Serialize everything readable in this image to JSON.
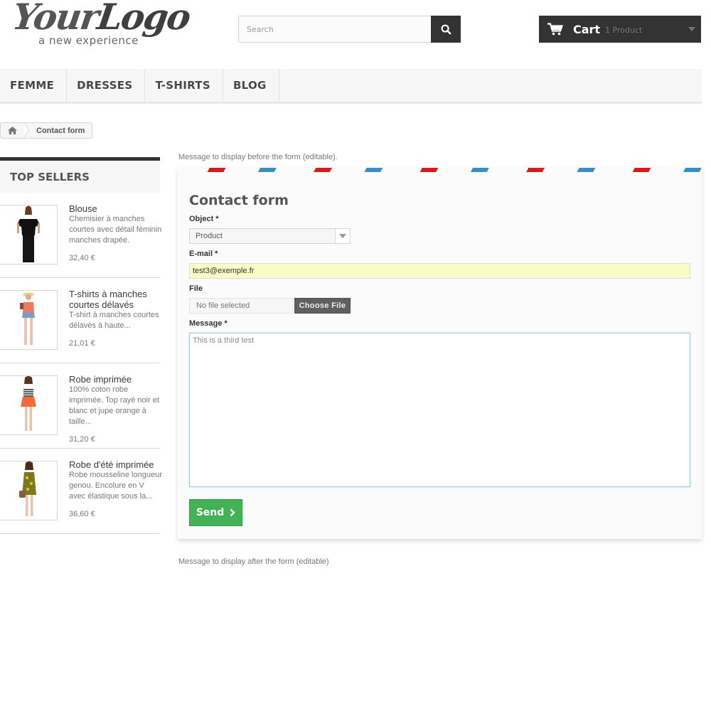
{
  "header": {
    "logo": {
      "script_part1": "Your",
      "script_part2": "Logo",
      "tagline": "a new experience"
    },
    "search": {
      "placeholder": "Search",
      "value": "",
      "icon": "search-icon"
    },
    "cart": {
      "label": "Cart",
      "quantity": "1 Product",
      "icon": "cart-icon"
    }
  },
  "menu": {
    "items": [
      {
        "label": "FEMME"
      },
      {
        "label": "DRESSES"
      },
      {
        "label": "T-SHIRTS"
      },
      {
        "label": "BLOG"
      }
    ]
  },
  "breadcrumb": {
    "home_icon": "home-icon",
    "current": "Contact form"
  },
  "sidebar": {
    "title": "TOP SELLERS",
    "products": [
      {
        "name": "Blouse",
        "description": "Chemisier à manches courtes avec détail féminin manches drapée.",
        "price": "32,40 €",
        "image": "black-blouse"
      },
      {
        "name": "T-shirts à manches courtes délavés",
        "description": "T-shirt à manches courtes délavés à haute...",
        "price": "21,01 €",
        "image": "orange-tshirt"
      },
      {
        "name": "Robe imprimée",
        "description": "100% coton robe imprimée. Top rayé noir et blanc et jupe orange à taille...",
        "price": "31,20 €",
        "image": "striped-dress"
      },
      {
        "name": "Robe d'été imprimée",
        "description": "Robe mousseline longueur genou. Encolure en V avec élastique sous la...",
        "price": "36,60 €",
        "image": "yellow-summer-dress"
      }
    ]
  },
  "main": {
    "before_message": "Message to display before the form (editable).",
    "after_message": "Message to display after the form (editable)",
    "stripe_colors": {
      "blue": "#3b8ec2",
      "red": "#d31d1d"
    },
    "form": {
      "title": "Contact form",
      "object_label": "Object *",
      "object_value": "Product",
      "email_label": "E-mail *",
      "email_value": "test3@exemple.fr",
      "file_label": "File",
      "file_status": "No file selected",
      "file_button": "Choose File",
      "message_label": "Message *",
      "message_value": "This is a third test",
      "send_label": "Send",
      "send_color": "#43b155"
    }
  }
}
